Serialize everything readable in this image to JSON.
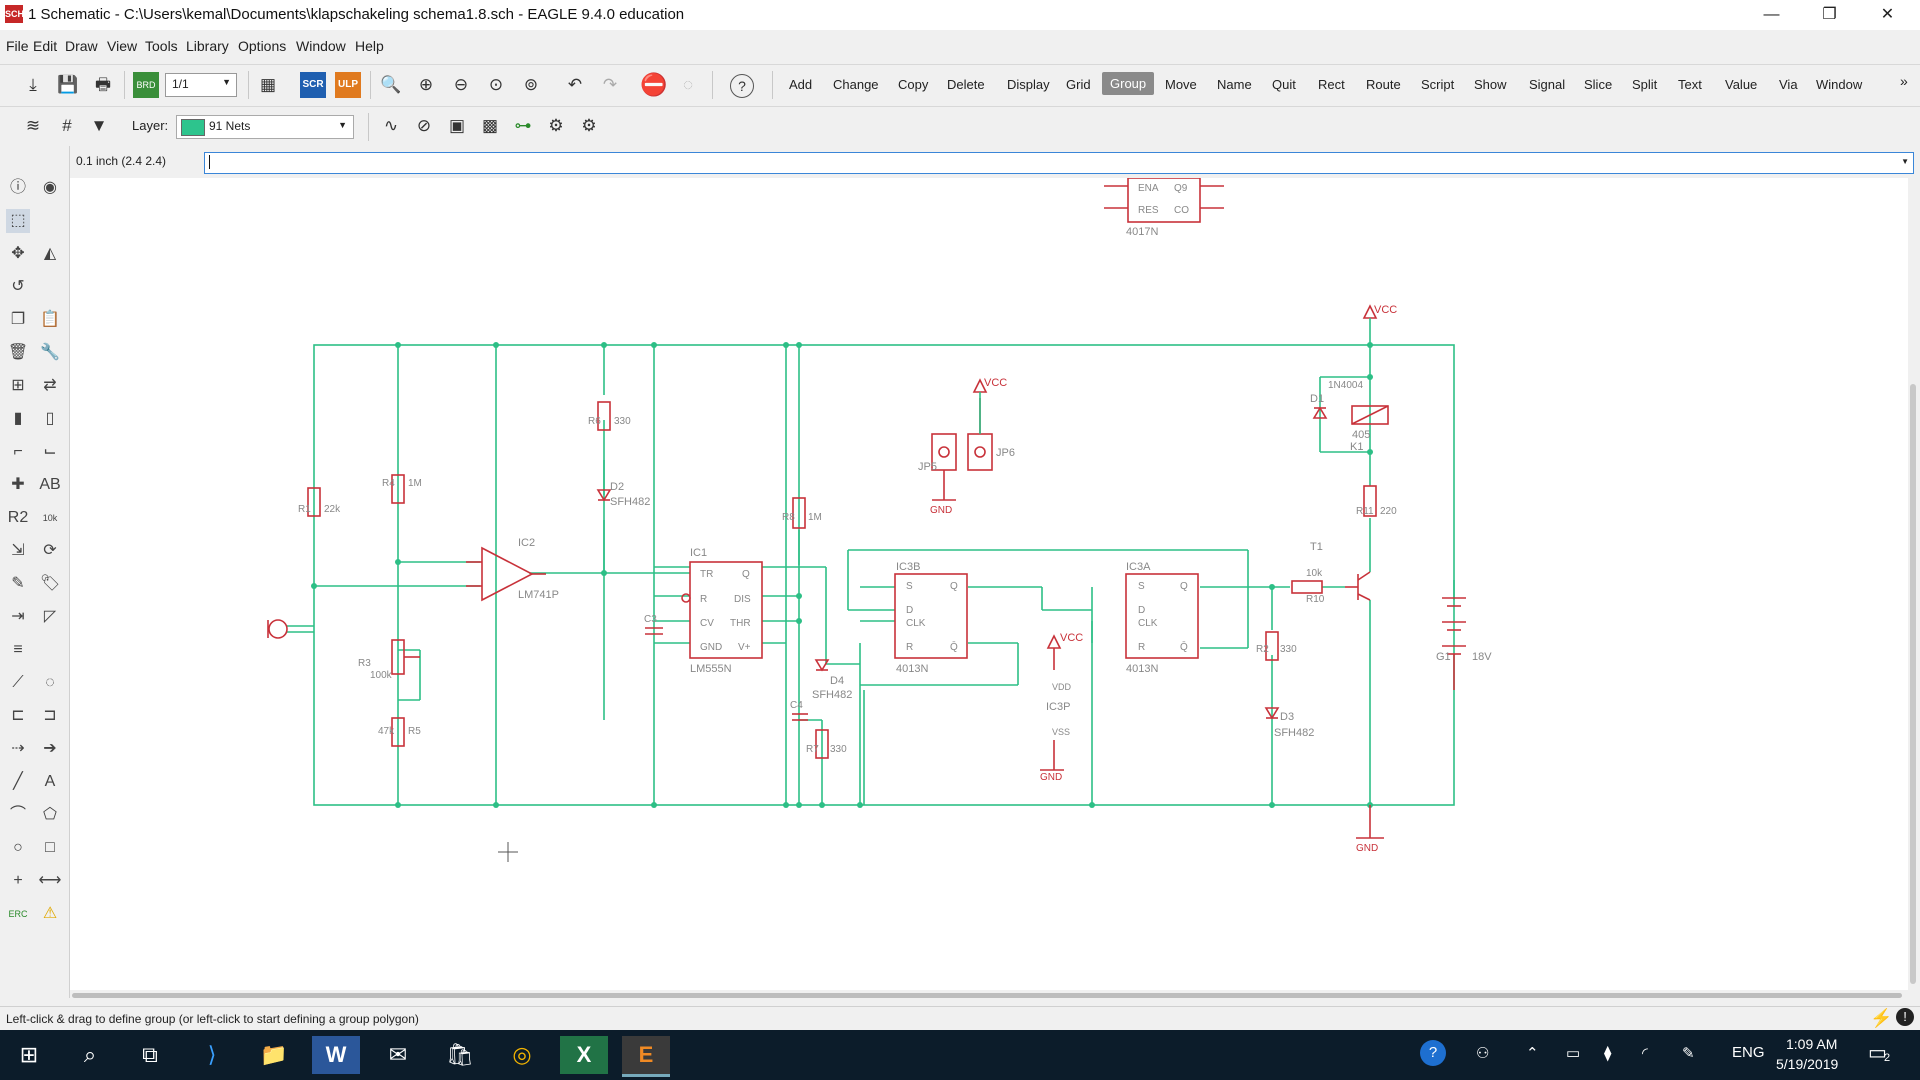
{
  "window": {
    "app_icon_text": "SCH",
    "title": "1 Schematic - C:\\Users\\kemal\\Documents\\klapschakeling schema1.8.sch - EAGLE 9.4.0 education",
    "minimize": "—",
    "maximize": "❐",
    "close": "✕"
  },
  "menu": [
    "File",
    "Edit",
    "Draw",
    "View",
    "Tools",
    "Library",
    "Options",
    "Window",
    "Help"
  ],
  "toolbar": {
    "sheet_value": "1/1",
    "scr_label": "SCR",
    "ulp_label": "ULP",
    "help_label": "?",
    "commands": [
      "Add",
      "Change",
      "Copy",
      "Delete",
      "Display",
      "Grid",
      "Group",
      "Move",
      "Name",
      "Quit",
      "Rect",
      "Route",
      "Script",
      "Show",
      "Signal",
      "Slice",
      "Split",
      "Text",
      "Value",
      "Via",
      "Window"
    ],
    "active_command": "Group",
    "overflow": "»"
  },
  "layer_bar": {
    "label": "Layer:",
    "selected_layer": "91 Nets",
    "layer_color": "#2dc48d"
  },
  "command_line": {
    "grid_readout": "0.1 inch (2.4 2.4)",
    "value": ""
  },
  "left_tools": [
    {
      "icon": "info-icon",
      "glyph": "ⓘ"
    },
    {
      "icon": "eye-icon",
      "glyph": "◉"
    },
    {
      "icon": "select-icon",
      "glyph": "⬚"
    },
    {
      "icon": "blank-icon",
      "glyph": ""
    },
    {
      "icon": "move-icon",
      "glyph": "✥"
    },
    {
      "icon": "mirror-icon",
      "glyph": "◭"
    },
    {
      "icon": "rotate-icon",
      "glyph": "↺"
    },
    {
      "icon": "blank2-icon",
      "glyph": ""
    },
    {
      "icon": "copy-icon",
      "glyph": "❐"
    },
    {
      "icon": "paste-icon",
      "glyph": "📋"
    },
    {
      "icon": "delete-icon",
      "glyph": "🗑"
    },
    {
      "icon": "wrench-icon",
      "glyph": "🔧"
    },
    {
      "icon": "add-part-icon",
      "glyph": "⊞"
    },
    {
      "icon": "replace-icon",
      "glyph": "⇄"
    },
    {
      "icon": "gate-icon",
      "glyph": "▮"
    },
    {
      "icon": "invoke-icon",
      "glyph": "▯"
    },
    {
      "icon": "net-icon",
      "glyph": "⌐"
    },
    {
      "icon": "bus-icon",
      "glyph": "⌙"
    },
    {
      "icon": "junction-icon",
      "glyph": "✚"
    },
    {
      "icon": "label-icon",
      "glyph": "AB"
    },
    {
      "icon": "name-icon",
      "glyph": "R2"
    },
    {
      "icon": "value-icon",
      "glyph": "10k"
    },
    {
      "icon": "smash-icon",
      "glyph": "⇲"
    },
    {
      "icon": "miter-icon",
      "glyph": "⟳"
    },
    {
      "icon": "split-icon",
      "glyph": "✎"
    },
    {
      "icon": "attribute-icon",
      "glyph": "🏷"
    },
    {
      "icon": "pinswap-icon",
      "glyph": "⇥"
    },
    {
      "icon": "gateswap-icon",
      "glyph": "◸"
    },
    {
      "icon": "align-icon",
      "glyph": "≡"
    },
    {
      "icon": "blank3-icon",
      "glyph": ""
    },
    {
      "icon": "wire-icon",
      "glyph": "⟋"
    },
    {
      "icon": "circle-dash-icon",
      "glyph": "◌"
    },
    {
      "icon": "bracket-icon",
      "glyph": "⊏"
    },
    {
      "icon": "bracket2-icon",
      "glyph": "⊐"
    },
    {
      "icon": "dash-icon",
      "glyph": "⇢"
    },
    {
      "icon": "arrow-icon",
      "glyph": "➔"
    },
    {
      "icon": "line-icon",
      "glyph": "╱"
    },
    {
      "icon": "text-icon",
      "glyph": "A"
    },
    {
      "icon": "arc-icon",
      "glyph": "⌒"
    },
    {
      "icon": "polygon-icon",
      "glyph": "⬠"
    },
    {
      "icon": "circle-icon",
      "glyph": "○"
    },
    {
      "icon": "rect-icon",
      "glyph": "□"
    },
    {
      "icon": "mark-icon",
      "glyph": "+"
    },
    {
      "icon": "dimension-icon",
      "glyph": "⟷"
    },
    {
      "icon": "erc-icon",
      "glyph": "ERC"
    },
    {
      "icon": "warning-icon",
      "glyph": "⚠"
    }
  ],
  "schematic": {
    "labels": {
      "ic2": "IC2",
      "ic2_type": "LM741P",
      "ic1": "IC1",
      "ic1_type": "LM555N",
      "ic1_pins": [
        "TR",
        "Q",
        "R",
        "DIS",
        "CV",
        "THR",
        "GND",
        "V+"
      ],
      "ic3b": "IC3B",
      "ic3b_type": "4013N",
      "ic3a": "IC3A",
      "ic3a_type": "4013N",
      "ic3p": "IC3P",
      "dff_pins": [
        "S",
        "Q",
        "D",
        "CLK",
        "R",
        "Q̄"
      ],
      "top_ic_pins": [
        "ENA",
        "Q9",
        "RES",
        "CO"
      ],
      "top_ic_type": "4017N",
      "vcc": "VCC",
      "gnd": "GND",
      "r1": "R1",
      "r1_val": "22k",
      "r4": "R4",
      "r4_val": "1M",
      "r3": "R3",
      "r3_val": "100k",
      "r5": "R5",
      "r5_val": "47k",
      "r6": "R6",
      "r6_val": "330",
      "r8": "R8",
      "r8_val": "1M",
      "r7": "R7",
      "r7_val": "330",
      "r2": "R2",
      "r2_val": "330",
      "r10": "R10",
      "r10_val": "10k",
      "r11": "R11",
      "r11_val": "220",
      "d1": "D1",
      "d1_val": "1N4004",
      "d2": "D2",
      "d2_val": "SFH482",
      "d3": "D3",
      "d3_val": "SFH482",
      "d4": "D4",
      "d4_val": "SFH482",
      "c3": "C3",
      "c4": "C4",
      "k1": "K1",
      "k1_val": "405",
      "t1": "T1",
      "g1": "G1",
      "g1_val": "18V",
      "jp5": "JP5",
      "jp6": "JP6",
      "vdd": "VDD",
      "vss": "VSS"
    }
  },
  "status": {
    "hint": "Left-click & drag to define group (or left-click to start defining a group polygon)"
  },
  "taskbar": {
    "apps": [
      {
        "icon": "windows-start-icon",
        "glyph": "⊞"
      },
      {
        "icon": "search-icon",
        "glyph": "⌕"
      },
      {
        "icon": "task-view-icon",
        "glyph": "⧉"
      },
      {
        "icon": "visual-studio-icon",
        "glyph": "⟩"
      },
      {
        "icon": "file-explorer-icon",
        "glyph": "📁"
      },
      {
        "icon": "word-icon",
        "glyph": "W"
      },
      {
        "icon": "mail-icon",
        "glyph": "✉"
      },
      {
        "icon": "store-icon",
        "glyph": "🛍"
      },
      {
        "icon": "chrome-icon",
        "glyph": "◎"
      },
      {
        "icon": "excel-icon",
        "glyph": "X"
      },
      {
        "icon": "eagle-icon",
        "glyph": "E"
      }
    ],
    "language": "ENG",
    "time": "1:09 AM",
    "date": "5/19/2019",
    "notifications": "2"
  }
}
